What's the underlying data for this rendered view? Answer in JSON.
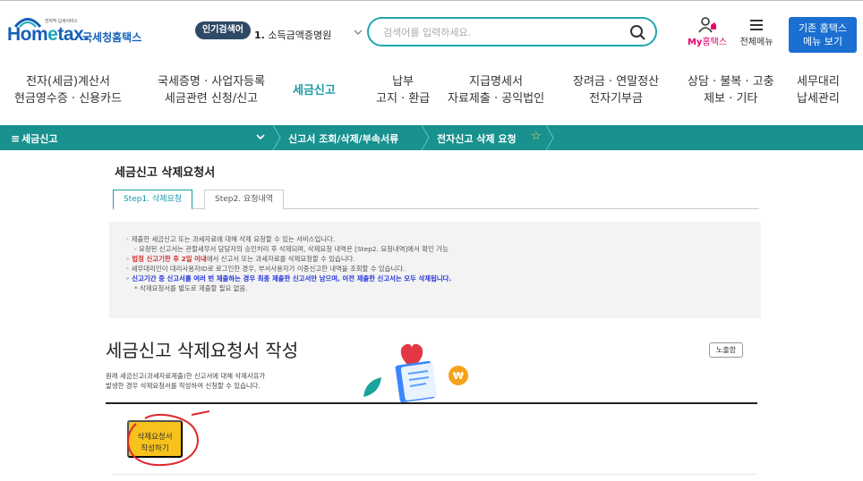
{
  "header": {
    "logo_micro": "전자적 납세서비스",
    "logo_brand_a": "Hom",
    "logo_brand_b": "e",
    "logo_brand_c": "tax.",
    "logo_ko": "국세청홈택스",
    "popular_badge": "인기검색어",
    "popular_rank": "1.",
    "popular_term": "소득금액증명원",
    "search_placeholder": "검색어를 입력하세요.",
    "my_home_prefix": "My",
    "my_home_suffix": "홈택스",
    "all_menu": "전체메뉴",
    "old_site_line1": "기존 홈택스",
    "old_site_line2": "메뉴 보기"
  },
  "gnb": [
    {
      "line1": "전자(세금)계산서",
      "line2": "현금영수증 · 신용카드"
    },
    {
      "line1": "국세증명 · 사업자등록",
      "line2": "세금관련 신청/신고"
    },
    {
      "line1": "세금신고",
      "line2": ""
    },
    {
      "line1": "납부",
      "line2": "고지 · 환급"
    },
    {
      "line1": "지급명세서",
      "line2": "자료제출 · 공익법인"
    },
    {
      "line1": "장려금 · 연말정산",
      "line2": "전자기부금"
    },
    {
      "line1": "상담 · 불복 · 고충",
      "line2": "제보 · 기타"
    },
    {
      "line1": "세무대리",
      "line2": "납세관리"
    }
  ],
  "breadcrumb": {
    "menu_icon": "≡",
    "section": "세금신고",
    "crumb1": "신고서 조회/삭제/부속서류",
    "crumb2": "전자신고 삭제 요청",
    "star": "☆"
  },
  "page": {
    "title": "세금신고 삭제요청서",
    "tabs": [
      "Step1. 삭제요청",
      "Step2. 요청내역"
    ],
    "notice": [
      "◦ 제출한 세금신고 또는 과세자료에 대해 삭제 요청할 수 있는 서비스입니다.",
      "- 요청된 신고서는 관할세무서 담당자의 승인처리 후 삭제되며, 삭제요청 내역은 [Step2. 요청내역]에서 확인 가능",
      "법정 신고기한 후 2일 이내",
      "에서 신고서 또는 과세자료를 삭제요청할 수 있습니다.",
      "◦ 세무대리인이 대리사용자ID로 로그인한 경우, 부서사용자가 이중신고한 내역을 조회할 수 있습니다.",
      "◦ 신고기간 중 신고서를 여러 번 제출하는 경우 최종 제출한 신고서만 남으며, 이전 제출한 신고서는 모두 삭제됩니다.",
      "* 삭제요청서를 별도로 제출할 필요 없음."
    ],
    "notice_red_bullet": "◦ ",
    "heading": "세금신고 삭제요청서 작성",
    "desc_line1": "원래 세금신고(과세자료제출)한 신고서에 대해 삭제사유가",
    "desc_line2": "발생한 경우 삭제요청서를 작성하여 신청할 수 있습니다.",
    "hide_button": "노출함",
    "write_button_line1": "삭제요청서",
    "write_button_line2": "작성하기"
  },
  "colors": {
    "brand": "#1560b8",
    "teal": "#18918f",
    "accent": "#1a9aa6",
    "pink": "#e5006e",
    "yellow": "#f8c21c",
    "red": "#d32f2f",
    "blue": "#2233d6"
  },
  "icons": [
    "house-arch-icon",
    "chevron-down-icon",
    "search-icon",
    "user-home-icon",
    "hamburger-icon",
    "star-icon",
    "heart-icon",
    "document-icon",
    "coin-icon",
    "leaf-icon"
  ]
}
